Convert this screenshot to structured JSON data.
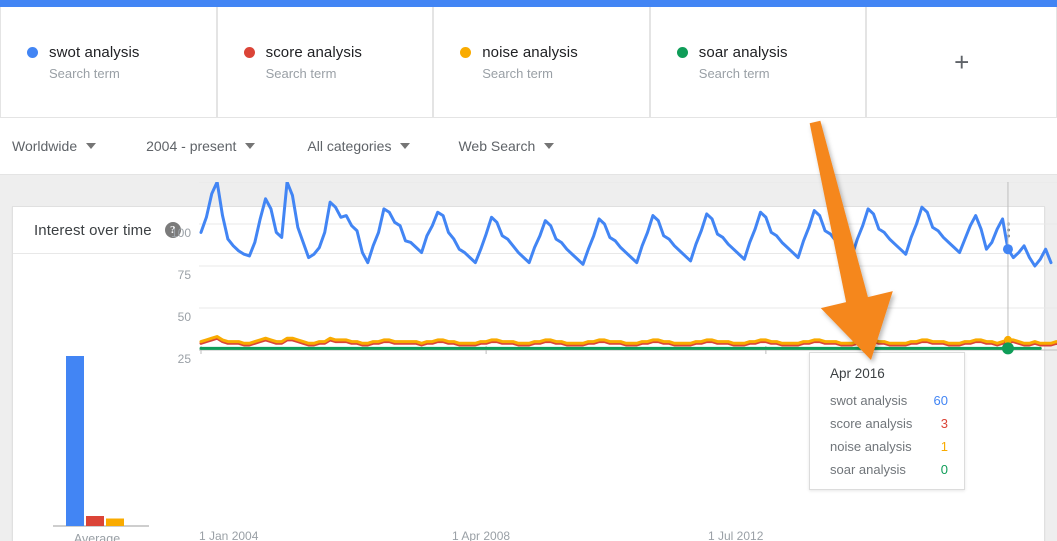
{
  "topbar": {
    "color": "#4285f4"
  },
  "terms": [
    {
      "name": "swot analysis",
      "sub": "Search term",
      "color": "#4285f4"
    },
    {
      "name": "score analysis",
      "sub": "Search term",
      "color": "#db4437"
    },
    {
      "name": "noise analysis",
      "sub": "Search term",
      "color": "#f9ab00"
    },
    {
      "name": "soar analysis",
      "sub": "Search term",
      "color": "#0f9d58"
    }
  ],
  "add_term": {
    "icon": "plus-icon",
    "label": "+"
  },
  "filters": [
    {
      "label": "Worldwide",
      "icon": "chevron-down-icon"
    },
    {
      "label": "2004 - present",
      "icon": "chevron-down-icon"
    },
    {
      "label": "All categories",
      "icon": "chevron-down-icon"
    },
    {
      "label": "Web Search",
      "icon": "chevron-down-icon"
    }
  ],
  "card": {
    "title": "Interest over time",
    "help_icon": "help-icon",
    "help_glyph": "?",
    "menu_icon": "more-vert-icon"
  },
  "tooltip": {
    "date": "Apr 2016",
    "rows": [
      {
        "name": "swot analysis",
        "value": "60",
        "color": "#4285f4"
      },
      {
        "name": "score analysis",
        "value": "3",
        "color": "#db4437"
      },
      {
        "name": "noise analysis",
        "value": "1",
        "color": "#f9ab00"
      },
      {
        "name": "soar analysis",
        "value": "0",
        "color": "#0f9d58"
      }
    ]
  },
  "annotation": {
    "type": "arrow",
    "color": "#f5871f",
    "points": "815,122 -> 872,358"
  },
  "chart_data": {
    "type": "line",
    "title": "Interest over time",
    "xlabel": "",
    "ylabel": "",
    "ylim": [
      0,
      100
    ],
    "yticks": [
      25,
      50,
      75,
      100
    ],
    "xticks": [
      "1 Jan 2004",
      "1 Apr 2008",
      "1 Jul 2012"
    ],
    "grid": true,
    "legend_position": "top",
    "average_panel": {
      "label": "Average",
      "categories": [
        "swot analysis",
        "score analysis",
        "noise analysis",
        "soar analysis"
      ],
      "values": [
        68,
        4,
        3,
        0
      ],
      "colors": [
        "#4285f4",
        "#db4437",
        "#f9ab00",
        "#0f9d58"
      ]
    },
    "series": [
      {
        "name": "swot analysis",
        "color": "#4285f4",
        "values": [
          70,
          79,
          93,
          100,
          80,
          66,
          62,
          59,
          57,
          56,
          64,
          78,
          90,
          84,
          70,
          67,
          100,
          92,
          73,
          64,
          55,
          57,
          61,
          70,
          88,
          85,
          79,
          80,
          74,
          71,
          58,
          52,
          62,
          70,
          84,
          82,
          76,
          74,
          65,
          64,
          61,
          58,
          68,
          74,
          82,
          80,
          70,
          66,
          60,
          58,
          55,
          52,
          60,
          69,
          79,
          76,
          68,
          66,
          62,
          58,
          55,
          52,
          61,
          68,
          77,
          74,
          66,
          64,
          60,
          57,
          54,
          51,
          60,
          68,
          78,
          75,
          67,
          65,
          61,
          58,
          55,
          52,
          62,
          70,
          80,
          77,
          68,
          66,
          62,
          59,
          56,
          53,
          63,
          71,
          81,
          78,
          69,
          67,
          63,
          60,
          57,
          54,
          64,
          72,
          82,
          79,
          70,
          68,
          64,
          61,
          58,
          55,
          65,
          73,
          83,
          80,
          71,
          69,
          65,
          62,
          59,
          56,
          66,
          74,
          84,
          81,
          72,
          70,
          66,
          63,
          60,
          57,
          67,
          75,
          85,
          82,
          73,
          71,
          67,
          64,
          61,
          58,
          66,
          74,
          80,
          72,
          60,
          64,
          72,
          78,
          60,
          55,
          58,
          62,
          55,
          50,
          54,
          60,
          52
        ]
      },
      {
        "name": "score analysis",
        "color": "#db4437",
        "values": [
          4,
          5,
          6,
          7,
          5,
          4,
          4,
          4,
          3,
          3,
          4,
          5,
          6,
          5,
          4,
          4,
          6,
          6,
          5,
          4,
          3,
          3,
          4,
          4,
          6,
          5,
          5,
          5,
          4,
          4,
          3,
          3,
          4,
          4,
          5,
          5,
          4,
          4,
          4,
          4,
          4,
          3,
          4,
          4,
          5,
          5,
          4,
          4,
          3,
          3,
          3,
          3,
          4,
          4,
          5,
          5,
          4,
          4,
          4,
          3,
          3,
          3,
          4,
          4,
          5,
          5,
          4,
          4,
          3,
          3,
          3,
          3,
          4,
          4,
          5,
          5,
          4,
          4,
          4,
          3,
          3,
          3,
          4,
          4,
          5,
          5,
          4,
          4,
          3,
          3,
          3,
          3,
          4,
          4,
          5,
          5,
          4,
          4,
          4,
          3,
          3,
          3,
          4,
          4,
          5,
          5,
          4,
          4,
          3,
          3,
          3,
          3,
          4,
          4,
          5,
          5,
          4,
          4,
          4,
          3,
          3,
          3,
          4,
          4,
          5,
          5,
          4,
          4,
          3,
          3,
          3,
          3,
          4,
          4,
          5,
          5,
          4,
          4,
          4,
          3,
          3,
          3,
          4,
          4,
          5,
          5,
          4,
          4,
          3,
          4,
          5,
          5,
          4,
          3,
          3,
          4,
          3,
          3,
          3,
          4,
          3
        ]
      },
      {
        "name": "noise analysis",
        "color": "#f9ab00",
        "values": [
          5,
          6,
          7,
          8,
          6,
          5,
          5,
          5,
          4,
          4,
          5,
          6,
          7,
          6,
          5,
          5,
          7,
          7,
          6,
          5,
          4,
          4,
          5,
          5,
          7,
          6,
          6,
          6,
          5,
          5,
          4,
          4,
          5,
          5,
          6,
          6,
          5,
          5,
          5,
          5,
          5,
          4,
          5,
          5,
          6,
          6,
          5,
          5,
          4,
          4,
          4,
          4,
          5,
          5,
          6,
          6,
          5,
          5,
          5,
          4,
          4,
          4,
          5,
          5,
          6,
          6,
          5,
          5,
          4,
          4,
          4,
          4,
          5,
          5,
          6,
          6,
          5,
          5,
          5,
          4,
          4,
          4,
          5,
          5,
          6,
          6,
          5,
          5,
          4,
          4,
          4,
          4,
          5,
          5,
          6,
          6,
          5,
          5,
          5,
          4,
          4,
          4,
          5,
          5,
          6,
          6,
          5,
          5,
          4,
          4,
          4,
          4,
          5,
          5,
          6,
          6,
          5,
          5,
          5,
          4,
          4,
          4,
          5,
          5,
          6,
          6,
          5,
          5,
          4,
          4,
          4,
          4,
          5,
          5,
          6,
          6,
          5,
          5,
          5,
          4,
          4,
          4,
          5,
          5,
          6,
          6,
          5,
          5,
          4,
          5,
          6,
          6,
          5,
          4,
          4,
          5,
          4,
          4,
          4,
          5,
          4
        ]
      },
      {
        "name": "soar analysis",
        "color": "#0f9d58",
        "values": [
          1,
          1,
          1,
          1,
          1,
          1,
          1,
          1,
          1,
          1,
          1,
          1,
          1,
          1,
          1,
          1,
          1,
          1,
          1,
          1,
          1,
          1,
          1,
          1,
          1,
          1,
          1,
          1,
          1,
          1,
          1,
          1,
          1,
          1,
          1,
          1,
          1,
          1,
          1,
          1,
          1,
          1,
          1,
          1,
          1,
          1,
          1,
          1,
          1,
          1,
          1,
          1,
          1,
          1,
          1,
          1,
          1,
          1,
          1,
          1,
          1,
          1,
          1,
          1,
          1,
          1,
          1,
          1,
          1,
          1,
          1,
          1,
          1,
          1,
          1,
          1,
          1,
          1,
          1,
          1,
          1,
          1,
          1,
          1,
          1,
          1,
          1,
          1,
          1,
          1,
          1,
          1,
          1,
          1,
          1,
          1,
          1,
          1,
          1,
          1,
          1,
          1,
          1,
          1,
          1,
          1,
          1,
          1,
          1,
          1,
          1,
          1,
          1,
          1,
          1,
          1,
          1,
          1,
          1,
          1,
          1,
          1,
          1,
          1,
          1,
          1,
          1,
          1,
          1,
          1,
          1,
          1,
          1,
          1,
          1,
          1,
          1,
          1,
          1,
          1,
          1,
          1,
          1,
          1,
          1,
          1,
          1,
          1,
          1,
          1,
          1,
          1,
          1,
          1,
          1,
          1,
          1
        ]
      }
    ],
    "hover_marker": {
      "index": 150,
      "label": "Apr 2016"
    }
  }
}
